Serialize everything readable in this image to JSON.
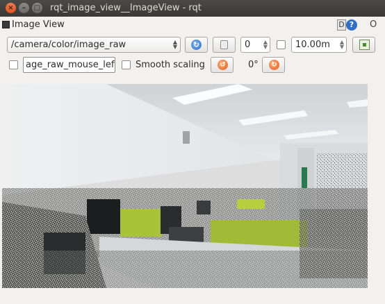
{
  "window": {
    "title": "rqt_image_view__ImageView - rqt",
    "close_glyph": "×",
    "minimize_glyph": "–",
    "maximize_glyph": "□"
  },
  "plugin": {
    "title": "Image View",
    "header_d": "D",
    "header_help": "?",
    "header_o": "O"
  },
  "toolbar": {
    "topic": "/camera/color/image_raw",
    "refresh_icon": "refresh-icon",
    "pause_icon": "pause-icon",
    "rotation_spin_value": "0",
    "max_depth_value": "10.00m",
    "save_icon": "save-icon",
    "mouse_topic_value": "age_raw_mouse_left",
    "smooth_scaling_label": "Smooth scaling",
    "rotation_value": "0°"
  },
  "colors": {
    "titlebar": "#3b3a36",
    "close_button": "#e0531f",
    "refresh_icon": "#2d6ec5",
    "rotate_icon": "#e2561c",
    "monitor_chair": "#a8c23a"
  }
}
